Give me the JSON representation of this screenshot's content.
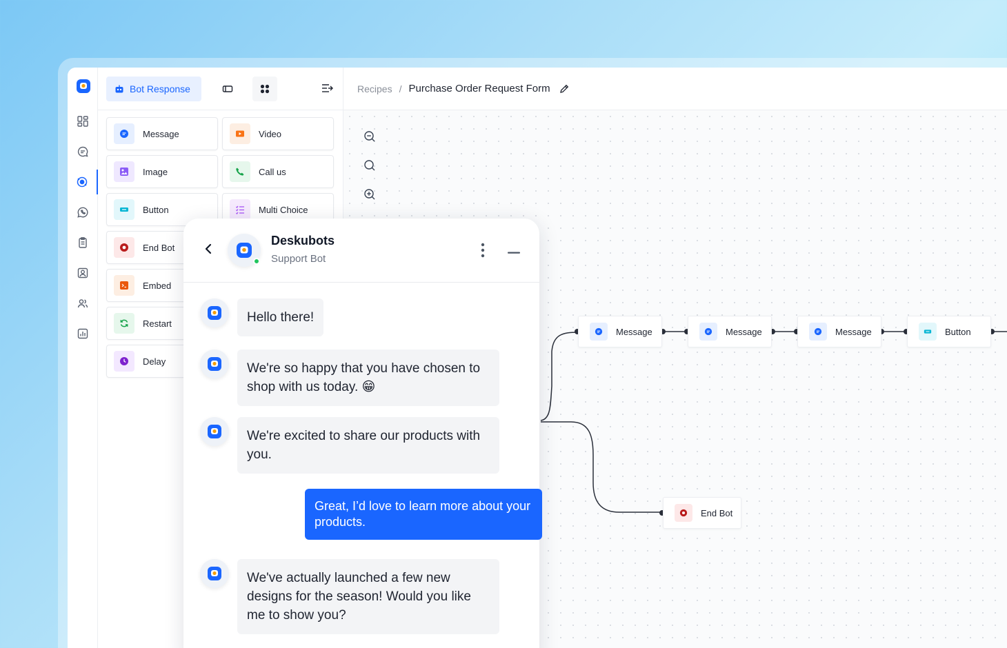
{
  "palette": {
    "active_tab": "Bot Response",
    "blocks": [
      {
        "label": "Message",
        "icon": "chat-bubble-icon",
        "color": "#1a66ff",
        "bg": "#e6efff"
      },
      {
        "label": "Video",
        "icon": "video-icon",
        "color": "#f97316",
        "bg": "#fdeee2"
      },
      {
        "label": "Image",
        "icon": "image-icon",
        "color": "#8b5cf6",
        "bg": "#efe8ff"
      },
      {
        "label": "Call us",
        "icon": "phone-icon",
        "color": "#16a34a",
        "bg": "#e6f7ec"
      },
      {
        "label": "Button",
        "icon": "button-icon",
        "color": "#06b6d4",
        "bg": "#e2f7fb"
      },
      {
        "label": "Multi Choice",
        "icon": "list-icon",
        "color": "#a855f7",
        "bg": "#f5e9fd"
      },
      {
        "label": "End Bot",
        "icon": "stop-icon",
        "color": "#b91c1c",
        "bg": "#fde8e8"
      },
      {
        "label": "Embed",
        "icon": "embed-icon",
        "color": "#ea580c",
        "bg": "#fdeee2"
      },
      {
        "label": "Restart",
        "icon": "restart-icon",
        "color": "#16a34a",
        "bg": "#e6f7ec"
      },
      {
        "label": "Delay",
        "icon": "clock-icon",
        "color": "#7e22ce",
        "bg": "#f3e8ff"
      }
    ]
  },
  "breadcrumb": {
    "root": "Recipes",
    "separator": "/",
    "page": "Purchase Order Request Form"
  },
  "flow": {
    "nodes": [
      {
        "label": "Message"
      },
      {
        "label": "Message"
      },
      {
        "label": "Message"
      },
      {
        "label": "Button"
      },
      {
        "label": "End Bot"
      }
    ]
  },
  "chat": {
    "bot_name": "Deskubots",
    "bot_subtitle": "Support Bot",
    "messages": [
      {
        "from": "bot",
        "text": "Hello there!"
      },
      {
        "from": "bot",
        "text": "We're so happy that you have chosen to shop with us today. 😁"
      },
      {
        "from": "bot",
        "text": "We're excited to share our products with you."
      },
      {
        "from": "user",
        "text": "Great, I’d love to learn more about your products."
      },
      {
        "from": "bot",
        "text": "We've actually launched a few new designs for the season! Would you like me to show you?"
      }
    ]
  },
  "colors": {
    "accent": "#1a66ff",
    "online": "#22c55e"
  }
}
